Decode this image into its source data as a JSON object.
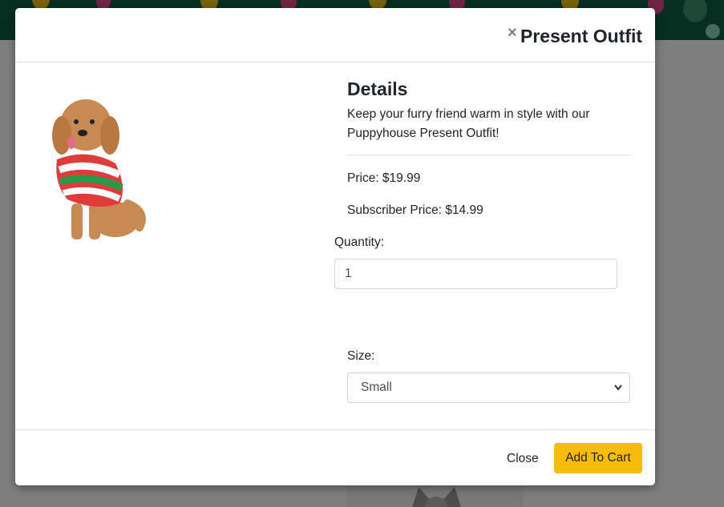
{
  "modal": {
    "close_icon": "×",
    "title": "Present Outfit"
  },
  "product": {
    "image_icon": "dog-in-holiday-sweater",
    "details_heading": "Details",
    "description": "Keep your furry friend warm in style with our Puppyhouse Present Outfit!",
    "price": "Price: $19.99",
    "subscriber_price": "Subscriber Price: $14.99"
  },
  "form": {
    "quantity_label": "Quantity:",
    "quantity_value": "1",
    "size_label": "Size:",
    "size_selected": "Small",
    "size_caret": "⌄"
  },
  "footer": {
    "close_label": "Close",
    "add_label": "Add To Cart"
  },
  "colors": {
    "accent": "#f7bc0a",
    "header_bg": "#0c5c43"
  }
}
